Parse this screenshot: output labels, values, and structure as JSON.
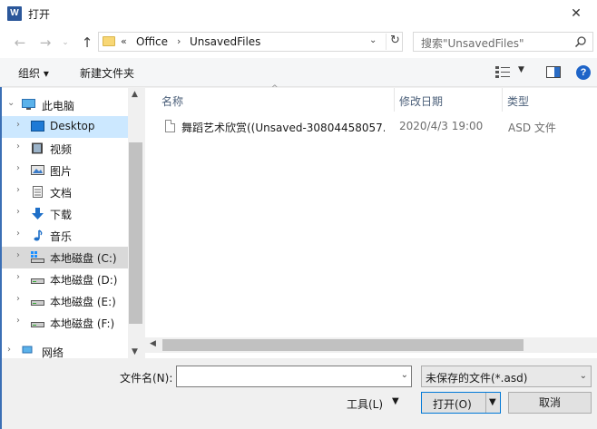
{
  "window": {
    "title": "打开",
    "app_icon": "W",
    "close_glyph": "✕"
  },
  "nav": {
    "back_glyph": "←",
    "forward_glyph": "→",
    "up_glyph": "↑",
    "dropdown_glyph": "⌄"
  },
  "address": {
    "overflow": "«",
    "crumbs": [
      "Office",
      "UnsavedFiles"
    ],
    "separator": "›",
    "dropdown_glyph": "⌄",
    "refresh_glyph": "↻"
  },
  "search": {
    "placeholder": "搜索\"UnsavedFiles\""
  },
  "toolbar": {
    "organize": "组织 ▾",
    "new_folder": "新建文件夹",
    "view_dd": "▼",
    "help": "?"
  },
  "sidebar": {
    "items": [
      {
        "label": "此电脑",
        "arrow": "⌄",
        "icon": "computer-icon"
      },
      {
        "label": "Desktop",
        "arrow": "›",
        "icon": "desktop-icon"
      },
      {
        "label": "视频",
        "arrow": "›",
        "icon": "video-icon"
      },
      {
        "label": "图片",
        "arrow": "›",
        "icon": "pictures-icon"
      },
      {
        "label": "文档",
        "arrow": "›",
        "icon": "documents-icon"
      },
      {
        "label": "下载",
        "arrow": "›",
        "icon": "download-icon"
      },
      {
        "label": "音乐",
        "arrow": "›",
        "icon": "music-icon"
      },
      {
        "label": "本地磁盘 (C:)",
        "arrow": "›",
        "icon": "drive-c-icon"
      },
      {
        "label": "本地磁盘 (D:)",
        "arrow": "›",
        "icon": "drive-icon"
      },
      {
        "label": "本地磁盘 (E:)",
        "arrow": "›",
        "icon": "drive-icon"
      },
      {
        "label": "本地磁盘 (F:)",
        "arrow": "›",
        "icon": "drive-icon"
      },
      {
        "label": "网络",
        "arrow": "›",
        "icon": "network-icon"
      }
    ]
  },
  "files": {
    "columns": {
      "name": "名称",
      "date": "修改日期",
      "type": "类型"
    },
    "sort_glyph": "^",
    "rows": [
      {
        "name": "舞蹈艺术欣赏((Unsaved-30804458057...",
        "date": "2020/4/3 19:00",
        "type": "ASD 文件"
      }
    ]
  },
  "scroll": {
    "up": "▲",
    "down": "▼",
    "left": "◀"
  },
  "footer": {
    "filename_label": "文件名(N):",
    "filename_value": "",
    "filename_dd": "⌄",
    "filetype": "未保存的文件(*.asd)",
    "filetype_dd": "⌄",
    "tools": "工具(L)",
    "tools_dd": "▼",
    "open": "打开(O)",
    "open_dd": "▼",
    "cancel": "取消"
  },
  "colors": {
    "selection": "#cce8ff",
    "accent": "#0078d7"
  }
}
